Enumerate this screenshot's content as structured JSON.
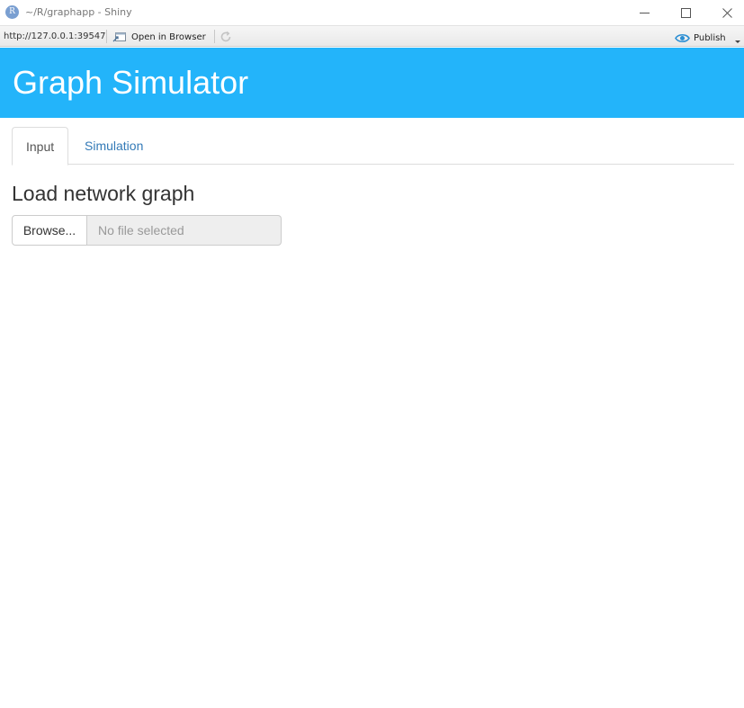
{
  "window": {
    "icon_letter": "R",
    "title": "~/R/graphapp - Shiny"
  },
  "toolbar": {
    "url": "http://127.0.0.1:39547",
    "open_in_browser_label": "Open in Browser",
    "publish_label": "Publish"
  },
  "app": {
    "title": "Graph Simulator",
    "header_color": "#23b4fa"
  },
  "tabs": [
    {
      "label": "Input",
      "active": true
    },
    {
      "label": "Simulation",
      "active": false
    }
  ],
  "input_tab": {
    "section_title": "Load network graph",
    "browse_label": "Browse...",
    "file_placeholder": "No file selected"
  },
  "icons": {
    "app": "r-logo-icon",
    "minimize": "minimize-icon",
    "maximize": "maximize-icon",
    "close": "close-icon",
    "open_browser": "open-in-browser-icon",
    "refresh": "refresh-icon",
    "publish": "publish-icon",
    "publish_menu": "chevron-down-icon"
  }
}
